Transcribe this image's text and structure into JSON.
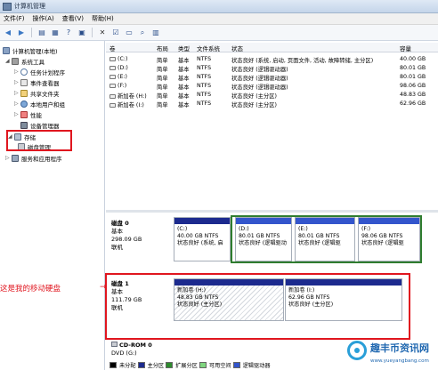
{
  "window": {
    "title": "计算机管理"
  },
  "menu": [
    "文件(F)",
    "操作(A)",
    "查看(V)",
    "帮助(H)"
  ],
  "tree": {
    "root": "计算机管理(本地)",
    "system_tools": "系统工具",
    "task_scheduler": "任务计划程序",
    "event_viewer": "事件查看器",
    "shared_folders": "共享文件夹",
    "local_users": "本地用户和组",
    "performance": "性能",
    "device_manager": "设备管理器",
    "storage": "存储",
    "disk_management": "磁盘管理",
    "services": "服务和应用程序"
  },
  "columns": {
    "volume": "卷",
    "layout": "布局",
    "type": "类型",
    "fs": "文件系统",
    "status": "状态",
    "capacity": "容量"
  },
  "volumes": [
    {
      "name": "(C:)",
      "layout": "简单",
      "type": "基本",
      "fs": "NTFS",
      "status": "状态良好 (系统, 启动, 页面文件, 活动, 故障转储, 主分区)",
      "capacity": "40.00 GB"
    },
    {
      "name": "(D:)",
      "layout": "简单",
      "type": "基本",
      "fs": "NTFS",
      "status": "状态良好 (逻辑驱动器)",
      "capacity": "80.01 GB"
    },
    {
      "name": "(E:)",
      "layout": "简单",
      "type": "基本",
      "fs": "NTFS",
      "status": "状态良好 (逻辑驱动器)",
      "capacity": "80.01 GB"
    },
    {
      "name": "(F:)",
      "layout": "简单",
      "type": "基本",
      "fs": "NTFS",
      "status": "状态良好 (逻辑驱动器)",
      "capacity": "98.06 GB"
    },
    {
      "name": "新加卷 (H:)",
      "layout": "简单",
      "type": "基本",
      "fs": "NTFS",
      "status": "状态良好 (主分区)",
      "capacity": "48.83 GB"
    },
    {
      "name": "新加卷 (I:)",
      "layout": "简单",
      "type": "基本",
      "fs": "NTFS",
      "status": "状态良好 (主分区)",
      "capacity": "62.96 GB"
    }
  ],
  "disk0": {
    "label": "磁盘 0",
    "type": "基本",
    "size": "298.09 GB",
    "state": "联机",
    "partitions": [
      {
        "name": "(C:)",
        "size": "40.00 GB NTFS",
        "status": "状态良好 (系统, 启"
      },
      {
        "name": "(D:)",
        "size": "80.01 GB NTFS",
        "status": "状态良好 (逻辑驱动"
      },
      {
        "name": "(E:)",
        "size": "80.01 GB NTFS",
        "status": "状态良好 (逻辑驱"
      },
      {
        "name": "(F:)",
        "size": "98.06 GB NTFS",
        "status": "状态良好 (逻辑驱"
      }
    ]
  },
  "disk1": {
    "label": "磁盘 1",
    "type": "基本",
    "size": "111.79 GB",
    "state": "联机",
    "partitions": [
      {
        "name": "新加卷 (H:)",
        "size": "48.83 GB NTFS",
        "status": "状态良好 (主分区)"
      },
      {
        "name": "新加卷 (I:)",
        "size": "62.96 GB NTFS",
        "status": "状态良好 (主分区)"
      }
    ]
  },
  "cdrom": {
    "label": "CD-ROM 0",
    "drive": "DVD (G:)"
  },
  "annotation": "这是我的移动硬盘",
  "legend": [
    {
      "label": "未分配",
      "color": "#000000"
    },
    {
      "label": "主分区",
      "color": "#1c2a8e"
    },
    {
      "label": "扩展分区",
      "color": "#2e8b2e"
    },
    {
      "label": "可用空间",
      "color": "#7fd67f"
    },
    {
      "label": "逻辑驱动器",
      "color": "#3355cc"
    }
  ],
  "watermark": {
    "text": "趣丰币资讯网",
    "url": "www.yueyangbang.com"
  }
}
